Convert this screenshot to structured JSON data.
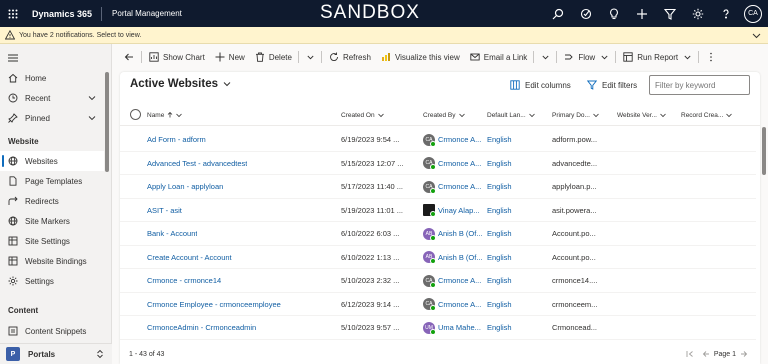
{
  "topbar": {
    "brand": "Dynamics 365",
    "app_name": "Portal Management",
    "environment_banner": "SANDBOX",
    "icons": [
      "search-icon",
      "target-icon",
      "lightbulb-icon",
      "plus-icon",
      "filter-icon",
      "gear-icon",
      "help-icon"
    ],
    "user_initials": "CA"
  },
  "notification": {
    "text": "You have 2 notifications. Select to view."
  },
  "sidebar": {
    "top_items": [
      {
        "label": "Home",
        "icon": "home-icon"
      },
      {
        "label": "Recent",
        "icon": "clock-icon"
      },
      {
        "label": "Pinned",
        "icon": "pin-icon"
      }
    ],
    "section_website": "Website",
    "website_items": [
      {
        "label": "Websites",
        "icon": "globe-icon",
        "active": true
      },
      {
        "label": "Page Templates",
        "icon": "document-icon"
      },
      {
        "label": "Redirects",
        "icon": "redirect-icon"
      },
      {
        "label": "Site Markers",
        "icon": "globe-icon"
      },
      {
        "label": "Site Settings",
        "icon": "table-icon"
      },
      {
        "label": "Website Bindings",
        "icon": "table-icon"
      },
      {
        "label": "Settings",
        "icon": "gear-icon"
      }
    ],
    "section_content": "Content",
    "content_items": [
      {
        "label": "Content Snippets",
        "icon": "snippet-icon"
      }
    ],
    "area_badge": "P",
    "area_label": "Portals"
  },
  "commandbar": {
    "show_chart": "Show Chart",
    "new": "New",
    "delete": "Delete",
    "refresh": "Refresh",
    "visualize": "Visualize this view",
    "email_link": "Email a Link",
    "flow": "Flow",
    "run_report": "Run Report"
  },
  "view": {
    "title": "Active Websites",
    "edit_columns": "Edit columns",
    "edit_filters": "Edit filters",
    "filter_placeholder": "Filter by keyword"
  },
  "grid": {
    "columns": {
      "name": "Name",
      "created_on": "Created On",
      "created_by": "Created By",
      "default_language": "Default Lan...",
      "primary_domain": "Primary Do...",
      "website_version": "Website Ver...",
      "record_created": "Record Crea..."
    },
    "rows": [
      {
        "name": "Ad Form - adform",
        "created_on": "6/19/2023 9:54 ...",
        "avatar": "CA",
        "avatar_style": "gray",
        "created_by": "Crmonce A...",
        "language": "English",
        "domain": "adform.pow..."
      },
      {
        "name": "Advanced Test - advancedtest",
        "created_on": "5/15/2023 12:07 ...",
        "avatar": "CA",
        "avatar_style": "gray",
        "created_by": "Crmonce A...",
        "language": "English",
        "domain": "advancedte..."
      },
      {
        "name": "Apply Loan - applyloan",
        "created_on": "5/17/2023 11:40 ...",
        "avatar": "CA",
        "avatar_style": "gray",
        "created_by": "Crmonce A...",
        "language": "English",
        "domain": "applyloan.p..."
      },
      {
        "name": "ASIT - asit",
        "created_on": "5/19/2023 11:01 ...",
        "avatar": "",
        "avatar_style": "black",
        "created_by": "Vinay Alap...",
        "language": "English",
        "domain": "asit.powera..."
      },
      {
        "name": "Bank - Account",
        "created_on": "6/10/2022 6:03 ...",
        "avatar": "AB",
        "avatar_style": "purple",
        "created_by": "Anish B (Of...",
        "language": "English",
        "domain": "Account.po..."
      },
      {
        "name": "Create Account - Account",
        "created_on": "6/10/2022 1:13 ...",
        "avatar": "AB",
        "avatar_style": "purple",
        "created_by": "Anish B (Of...",
        "language": "English",
        "domain": "Account.po..."
      },
      {
        "name": "Crmonce - crmonce14",
        "created_on": "5/10/2023 2:32 ...",
        "avatar": "CA",
        "avatar_style": "gray",
        "created_by": "Crmonce A...",
        "language": "English",
        "domain": "crmonce14...."
      },
      {
        "name": "Crmonce Employee - crmonceemployee",
        "created_on": "6/12/2023 9:14 ...",
        "avatar": "CA",
        "avatar_style": "gray",
        "created_by": "Crmonce A...",
        "language": "English",
        "domain": "crmonceem..."
      },
      {
        "name": "CrmonceAdmin - Crmonceadmin",
        "created_on": "5/10/2023 9:57 ...",
        "avatar": "UM",
        "avatar_style": "purple",
        "created_by": "Uma Mahe...",
        "language": "English",
        "domain": "Crmoncead..."
      }
    ]
  },
  "footer": {
    "record_count": "1 - 43 of 43",
    "page_label": "Page 1"
  }
}
